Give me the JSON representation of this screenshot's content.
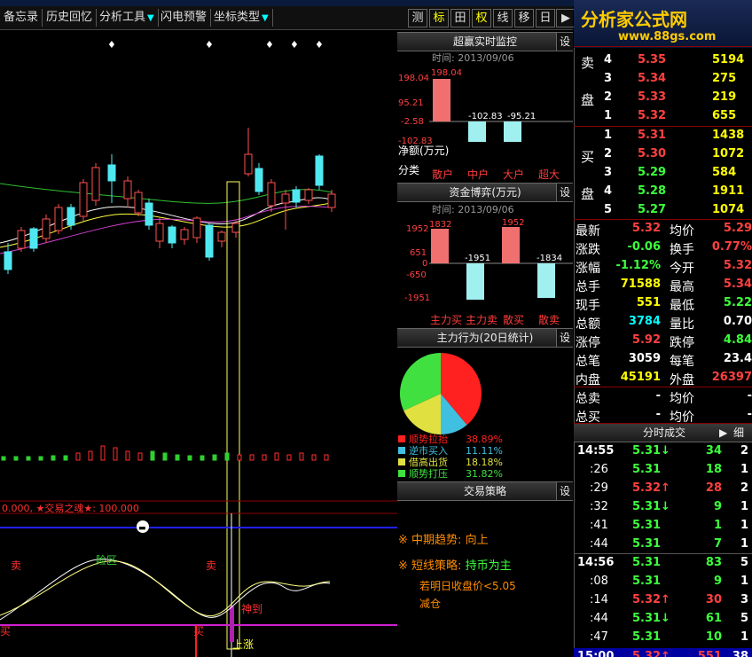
{
  "toolbar": {
    "items": [
      "备忘录",
      "历史回忆",
      "分析工具",
      "闪电预警",
      "坐标类型"
    ],
    "right_buttons": [
      "测",
      "标",
      "田",
      "权",
      "线",
      "移",
      "日",
      "▶"
    ]
  },
  "logo": {
    "title": "分析家公式网",
    "url": "www.88gs.com"
  },
  "main_chart": {
    "indicator_line": "0.000, ★交易之魂★: 100.000",
    "labels": {
      "sell1": "卖",
      "sell2": "卖",
      "danger": "险区",
      "buy1": "买",
      "buy2": "买",
      "god": "神到",
      "trend": "上涨"
    },
    "marks": [
      "♦",
      "♦",
      "♦",
      "♦",
      "♦",
      "♦"
    ]
  },
  "panel_super": {
    "title": "超赢实时监控",
    "set": "设",
    "date": "时间: 2013/09/06",
    "y_ticks": [
      "198.04",
      "95.21",
      "-2.58",
      "-102.83"
    ],
    "values": [
      {
        "label": "散户",
        "v": "198.04"
      },
      {
        "label": "中户",
        "v": "-102.83"
      },
      {
        "label": "大户",
        "v": "-95.21"
      },
      {
        "label": "超大",
        "v": ""
      }
    ],
    "net_label": "净额(万元)",
    "class_label": "分类"
  },
  "panel_fund": {
    "title": "资金博弈(万元)",
    "set": "设",
    "date": "时间: 2013/09/06",
    "y_ticks": [
      "1952",
      "651",
      "0",
      "-650",
      "-1951"
    ],
    "values": [
      {
        "label": "主力买",
        "v": "1832"
      },
      {
        "label": "主力卖",
        "v": "-1951"
      },
      {
        "label": "散买",
        "v": "1952"
      },
      {
        "label": "散卖",
        "v": "-1834"
      }
    ]
  },
  "panel_behavior": {
    "title": "主力行为(20日统计)",
    "set": "设",
    "legend": [
      {
        "name": "顺势拉抬",
        "pct": "38.89%",
        "color": "#ff2020"
      },
      {
        "name": "逆市买入",
        "pct": "11.11%",
        "color": "#40c0e0"
      },
      {
        "name": "借高出货",
        "pct": "18.18%",
        "color": "#e0e040"
      },
      {
        "name": "顺势打压",
        "pct": "31.82%",
        "color": "#40e040"
      }
    ],
    "chart_data": {
      "type": "pie",
      "values": [
        38.89,
        11.11,
        18.18,
        31.82
      ],
      "categories": [
        "顺势拉抬",
        "逆市买入",
        "借高出货",
        "顺势打压"
      ]
    }
  },
  "panel_strategy": {
    "title": "交易策略",
    "set": "设",
    "mid_label": "中期趋势:",
    "mid_value": "向上",
    "short_label": "短线策略:",
    "short_value": "持币为主",
    "note1": "若明日收盘价<5.05",
    "note2": "减仓"
  },
  "quote": {
    "sell_label": [
      "卖",
      "盘"
    ],
    "buy_label": [
      "买",
      "盘"
    ],
    "sells": [
      {
        "n": "4",
        "p": "5.35",
        "v": "5194"
      },
      {
        "n": "3",
        "p": "5.34",
        "v": "275"
      },
      {
        "n": "2",
        "p": "5.33",
        "v": "219"
      },
      {
        "n": "1",
        "p": "5.32",
        "v": "655"
      }
    ],
    "buys": [
      {
        "n": "1",
        "p": "5.31",
        "v": "1438"
      },
      {
        "n": "2",
        "p": "5.30",
        "v": "1072"
      },
      {
        "n": "3",
        "p": "5.29",
        "v": "584"
      },
      {
        "n": "4",
        "p": "5.28",
        "v": "1911"
      },
      {
        "n": "5",
        "p": "5.27",
        "v": "1074"
      }
    ],
    "stats": [
      {
        "l1": "最新",
        "v1": "5.32",
        "l2": "均价",
        "v2": "5.29"
      },
      {
        "l1": "涨跌",
        "v1": "-0.06",
        "l2": "换手",
        "v2": "0.77%"
      },
      {
        "l1": "涨幅",
        "v1": "-1.12%",
        "l2": "今开",
        "v2": "5.32"
      },
      {
        "l1": "总手",
        "v1": "71588",
        "l2": "最高",
        "v2": "5.34"
      },
      {
        "l1": "现手",
        "v1": "551",
        "l2": "最低",
        "v2": "5.22"
      },
      {
        "l1": "总额",
        "v1": "3784",
        "l2": "量比",
        "v2": "0.70"
      },
      {
        "l1": "涨停",
        "v1": "5.92",
        "l2": "跌停",
        "v2": "4.84"
      },
      {
        "l1": "总笔",
        "v1": "3059",
        "l2": "每笔",
        "v2": "23.4"
      },
      {
        "l1": "内盘",
        "v1": "45191",
        "l2": "外盘",
        "v2": "26397"
      }
    ],
    "total_sell": {
      "l": "总卖",
      "v": "-",
      "l2": "均价",
      "v2": "-"
    },
    "total_buy": {
      "l": "总买",
      "v": "-",
      "l2": "均价",
      "v2": "-"
    },
    "ticks_title": "分时成交",
    "ticks_detail": "细",
    "ticks": [
      {
        "t": "14:55",
        "p": "5.31",
        "a": "↓",
        "v": "34",
        "n": "2"
      },
      {
        "t": ":26",
        "p": "5.31",
        "a": "",
        "v": "18",
        "n": "1"
      },
      {
        "t": ":29",
        "p": "5.32",
        "a": "↑",
        "v": "28",
        "n": "2"
      },
      {
        "t": ":32",
        "p": "5.31",
        "a": "↓",
        "v": "9",
        "n": "1"
      },
      {
        "t": ":41",
        "p": "5.31",
        "a": "",
        "v": "1",
        "n": "1"
      },
      {
        "t": ":44",
        "p": "5.31",
        "a": "",
        "v": "7",
        "n": "1"
      },
      {
        "t": "14:56",
        "p": "5.31",
        "a": "",
        "v": "83",
        "n": "5"
      },
      {
        "t": ":08",
        "p": "5.31",
        "a": "",
        "v": "9",
        "n": "1"
      },
      {
        "t": ":14",
        "p": "5.32",
        "a": "↑",
        "v": "30",
        "n": "3"
      },
      {
        "t": ":44",
        "p": "5.31",
        "a": "↓",
        "v": "61",
        "n": "5"
      },
      {
        "t": ":47",
        "p": "5.31",
        "a": "",
        "v": "10",
        "n": "1"
      },
      {
        "t": "15:00",
        "p": "5.32",
        "a": "↑",
        "v": "551",
        "n": "38"
      }
    ]
  }
}
